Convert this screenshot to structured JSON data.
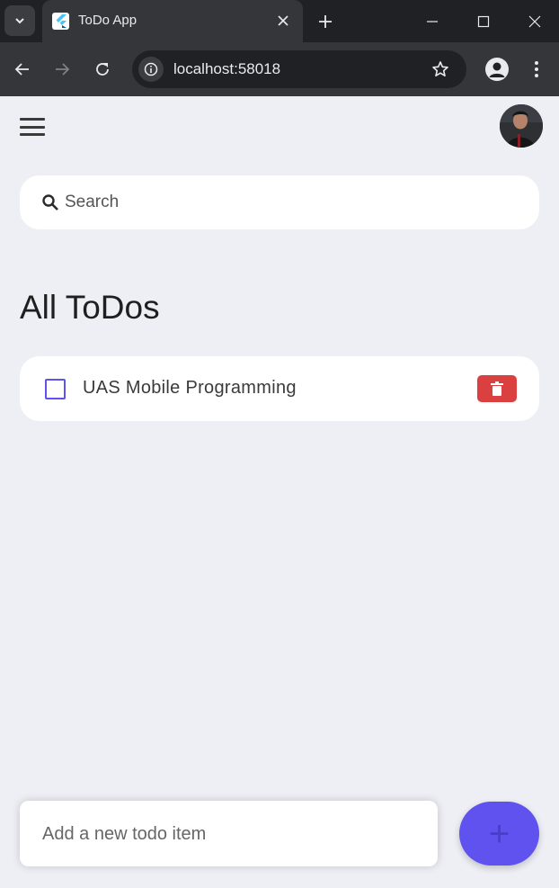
{
  "browser": {
    "tab_title": "ToDo App",
    "url": "localhost:58018"
  },
  "app": {
    "search": {
      "placeholder": "Search",
      "value": ""
    },
    "heading": "All ToDos",
    "todos": [
      {
        "text": "UAS Mobile Programming",
        "done": false
      }
    ],
    "new_todo": {
      "placeholder": "Add a new todo item",
      "value": ""
    },
    "fab_label": "+"
  },
  "colors": {
    "accent": "#5F52EE",
    "delete": "#DA4040",
    "background": "#EEEFF5"
  },
  "icons": {
    "menu": "hamburger-menu-icon",
    "search": "search-icon",
    "delete": "trash-icon",
    "add": "plus-icon"
  }
}
